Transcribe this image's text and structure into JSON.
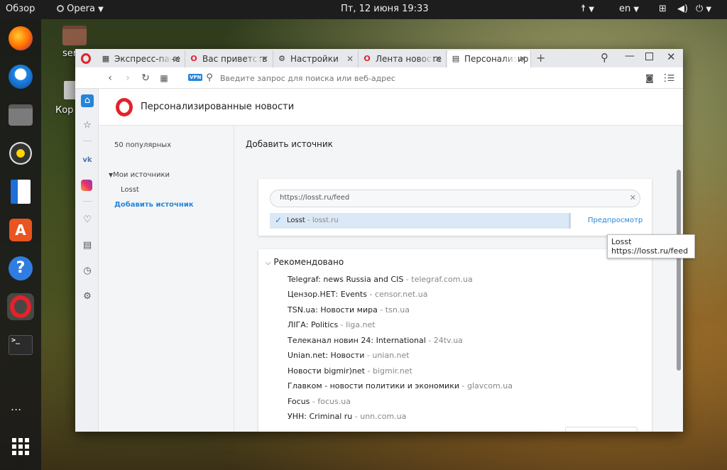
{
  "topbar": {
    "activities": "Обзор",
    "app_menu": "Opera",
    "clock": "Пт, 12 июня  19:33",
    "lang": "en"
  },
  "desktop": {
    "icons": [
      {
        "label": "ser"
      },
      {
        "label": "Кор"
      }
    ]
  },
  "dock": {
    "items": [
      {
        "icon": "firefox-icon"
      },
      {
        "icon": "thunderbird-icon"
      },
      {
        "icon": "files-icon"
      },
      {
        "icon": "rhythmbox-icon"
      },
      {
        "icon": "libreoffice-writer-icon"
      },
      {
        "icon": "software-center-icon"
      },
      {
        "icon": "help-icon"
      },
      {
        "icon": "opera-icon"
      },
      {
        "icon": "terminal-icon"
      }
    ],
    "more": "...",
    "apps_grid": "show-apps-icon"
  },
  "browser": {
    "tabs": [
      {
        "label": "Экспресс-пане",
        "icon": "speed-dial-icon"
      },
      {
        "label": "Вас приветств",
        "icon": "opera-tab-icon"
      },
      {
        "label": "Настройки",
        "icon": "settings-tab-icon"
      },
      {
        "label": "Лента новосте",
        "icon": "opera-tab-icon"
      },
      {
        "label": "Персонализир",
        "icon": "news-tab-icon"
      }
    ],
    "new_tab": "+",
    "address": {
      "vpn": "VPN",
      "placeholder": "Введите запрос для поиска или веб-адрес"
    }
  },
  "news_page": {
    "title": "Персонализированные новости",
    "nav": {
      "popular": "50 популярных",
      "my_sources": "Мои источники",
      "source_items": [
        "Losst"
      ],
      "add_source": "Добавить источник"
    },
    "main": {
      "heading": "Добавить источник",
      "feed_input_value": "https://losst.ru/feed",
      "result_name": "Losst",
      "result_domain": "losst.ru",
      "preview": "Предпросмотр",
      "recommended_title": "Рекомендовано",
      "recommended": [
        {
          "name": "Telegraf: news Russia and CIS",
          "domain": "telegraf.com.ua"
        },
        {
          "name": "Цензор.НЕТ: Events",
          "domain": "censor.net.ua"
        },
        {
          "name": "TSN.ua: Новости мира",
          "domain": "tsn.ua"
        },
        {
          "name": "ЛІГА: Politics",
          "domain": "liga.net"
        },
        {
          "name": "Телеканал новин 24: International",
          "domain": "24tv.ua"
        },
        {
          "name": "Unian.net: Новости",
          "domain": "unian.net"
        },
        {
          "name": "Новости bigmir)net",
          "domain": "bigmir.net"
        },
        {
          "name": "Главком - новости политики и экономики",
          "domain": "glavcom.ua"
        },
        {
          "name": "Focus",
          "domain": "focus.ua"
        },
        {
          "name": "УНН: Criminal ru",
          "domain": "unn.com.ua"
        }
      ]
    },
    "tooltip": {
      "line1": "Losst",
      "line2": "https://losst.ru/feed"
    }
  },
  "colors": {
    "accent": "#2585d9",
    "opera_red": "#e3222b",
    "selected_row": "#dbe8f5"
  }
}
